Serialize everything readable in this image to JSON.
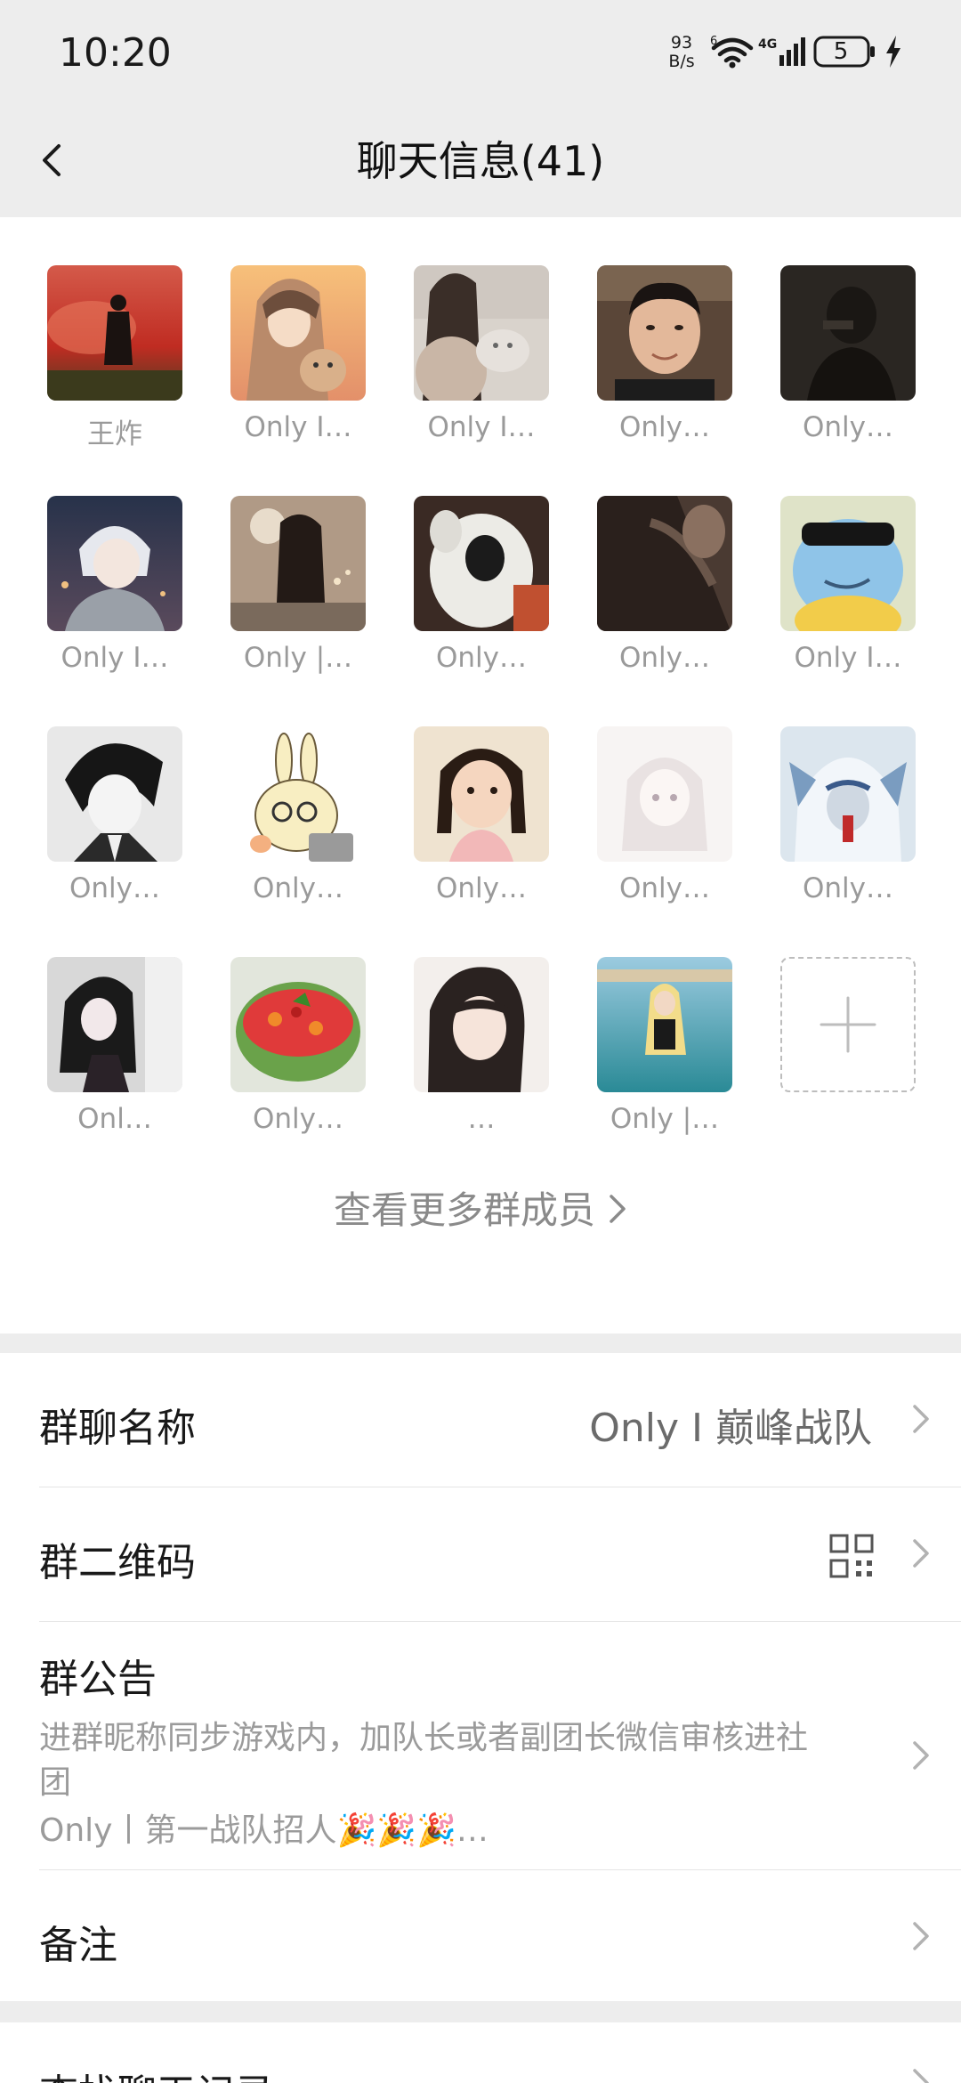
{
  "status_bar": {
    "time": "10:20",
    "net_speed_value": "93",
    "net_speed_unit": "B/s",
    "network_type": "4G",
    "wifi_badge": "6",
    "battery_level": "5",
    "icons": [
      "wifi-icon",
      "cellular-signal-icon",
      "battery-icon",
      "charging-bolt-icon"
    ]
  },
  "nav": {
    "title": "聊天信息(41)",
    "back_icon": "chevron-left-icon"
  },
  "members": {
    "list": [
      {
        "name": "王炸",
        "avatar": "silhouette-red-field"
      },
      {
        "name": "Only I…",
        "avatar": "anime-girl-with-cat-sunset"
      },
      {
        "name": "Only I…",
        "avatar": "girl-holding-cat"
      },
      {
        "name": "Only…",
        "avatar": "man-portrait"
      },
      {
        "name": "Only…",
        "avatar": "dark-silhouette"
      },
      {
        "name": "Only I…",
        "avatar": "anime-boy-white-hair"
      },
      {
        "name": "Only |…",
        "avatar": "girl-long-hair-room"
      },
      {
        "name": "Only…",
        "avatar": "plush-dog"
      },
      {
        "name": "Only…",
        "avatar": "dark-hair-photo"
      },
      {
        "name": "Only I…",
        "avatar": "squirtle-sunglasses"
      },
      {
        "name": "Only…",
        "avatar": "anime-boy-monochrome"
      },
      {
        "name": "Only…",
        "avatar": "cartoon-bunny-laptop"
      },
      {
        "name": "Only…",
        "avatar": "little-girl"
      },
      {
        "name": "Only…",
        "avatar": "pale-anime-girl"
      },
      {
        "name": "Only…",
        "avatar": "anime-blue-hood"
      },
      {
        "name": "Onl…",
        "avatar": "anime-girl-balcony"
      },
      {
        "name": "Only…",
        "avatar": "watermelon-fruit"
      },
      {
        "name": "…",
        "avatar": "girl-bangs-photo"
      },
      {
        "name": "Only |…",
        "avatar": "girl-in-sea"
      }
    ],
    "add_button_icon": "plus-icon",
    "more_link": "查看更多群成员"
  },
  "settings": {
    "group_name": {
      "label": "群聊名称",
      "value": "Only I 巅峰战队"
    },
    "qr_code": {
      "label": "群二维码",
      "icon": "qr-code-icon"
    },
    "announcement": {
      "label": "群公告",
      "line1": "进群昵称同步游戏内，加队长或者副团长微信审核进社",
      "line2": "团",
      "line3": "Only丨第一战队招人🎉🎉🎉…"
    },
    "remark": {
      "label": "备注"
    },
    "search_history": {
      "label": "查找聊天记录"
    }
  },
  "colors": {
    "page_bg": "#ededed",
    "panel_bg": "#ffffff",
    "muted_text": "#9a9a9a"
  }
}
